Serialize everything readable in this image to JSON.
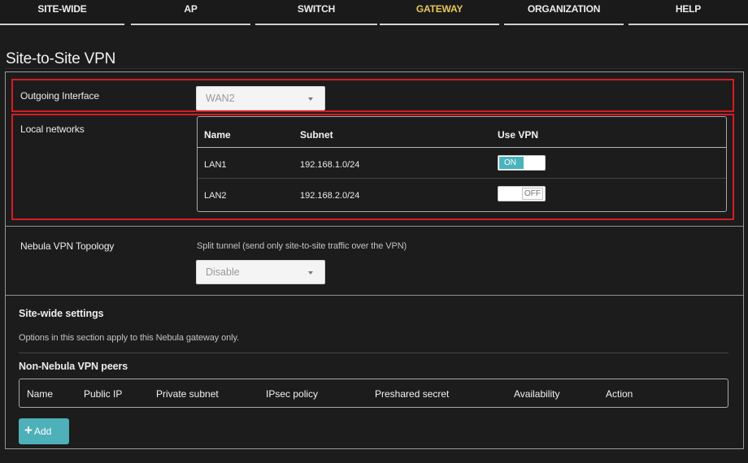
{
  "nav": {
    "tabs": [
      {
        "label": "SITE-WIDE"
      },
      {
        "label": "AP"
      },
      {
        "label": "SWITCH"
      },
      {
        "label": "GATEWAY"
      },
      {
        "label": "ORGANIZATION"
      },
      {
        "label": "HELP"
      }
    ],
    "active_tab": "GATEWAY"
  },
  "page": {
    "title": "Site-to-Site VPN"
  },
  "outgoing_interface": {
    "label": "Outgoing Interface",
    "value": "WAN2"
  },
  "local_networks": {
    "label": "Local networks",
    "headers": {
      "name": "Name",
      "subnet": "Subnet",
      "use_vpn": "Use VPN"
    },
    "rows": [
      {
        "name": "LAN1",
        "subnet": "192.168.1.0/24",
        "use_vpn": "ON"
      },
      {
        "name": "LAN2",
        "subnet": "192.168.2.0/24",
        "use_vpn": "OFF"
      }
    ]
  },
  "topology": {
    "label": "Nebula VPN Topology",
    "description": "Split tunnel (send only site-to-site traffic over the VPN)",
    "value": "Disable"
  },
  "site_wide": {
    "title": "Site-wide settings",
    "note": "Options in this section apply to this Nebula gateway only."
  },
  "peers": {
    "title": "Non-Nebula VPN peers",
    "headers": {
      "name": "Name",
      "public_ip": "Public IP",
      "private_subnet": "Private subnet",
      "ipsec_policy": "IPsec policy",
      "preshared_secret": "Preshared secret",
      "availability": "Availability",
      "action": "Action"
    },
    "add_label": "Add"
  },
  "colors": {
    "accent": "#4eb0b8",
    "active_tab": "#e8c75a",
    "highlight": "#d71c24",
    "background": "#1c1c1c"
  }
}
